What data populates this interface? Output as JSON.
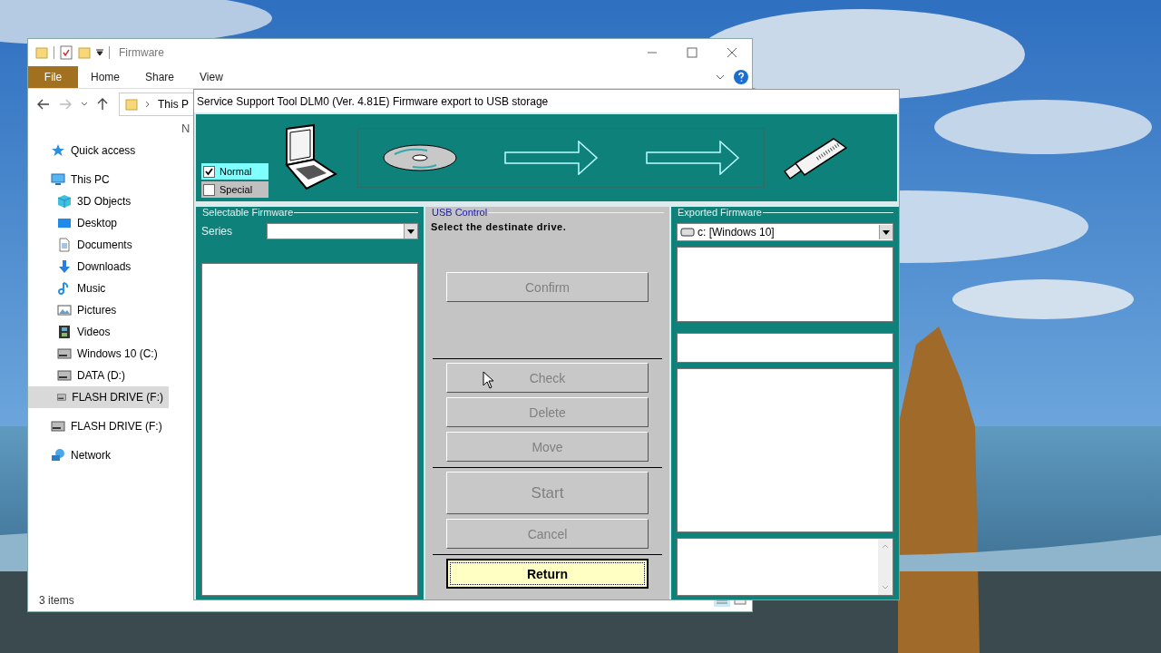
{
  "explorer": {
    "title": "Firmware",
    "ribbon_tabs": [
      {
        "label": "File",
        "selected": true
      },
      {
        "label": "Home",
        "selected": false
      },
      {
        "label": "Share",
        "selected": false
      },
      {
        "label": "View",
        "selected": false
      }
    ],
    "address": "This P",
    "column_1": "N",
    "nav": [
      {
        "label": "Quick access",
        "kind": "star",
        "selected": false
      },
      {
        "label": "This PC",
        "kind": "pc",
        "selected": false,
        "children": [
          {
            "label": "3D Objects",
            "kind": "cube",
            "selected": false
          },
          {
            "label": "Desktop",
            "kind": "desktop",
            "selected": false
          },
          {
            "label": "Documents",
            "kind": "document",
            "selected": false
          },
          {
            "label": "Downloads",
            "kind": "download",
            "selected": false
          },
          {
            "label": "Music",
            "kind": "music",
            "selected": false
          },
          {
            "label": "Pictures",
            "kind": "pictures",
            "selected": false
          },
          {
            "label": "Videos",
            "kind": "film",
            "selected": false
          },
          {
            "label": "Windows 10 (C:)",
            "kind": "drive",
            "selected": false
          },
          {
            "label": "DATA (D:)",
            "kind": "drive",
            "selected": false
          },
          {
            "label": "FLASH DRIVE (F:)",
            "kind": "drive",
            "selected": true
          }
        ]
      },
      {
        "label": "FLASH DRIVE (F:)",
        "kind": "drive",
        "selected": false
      },
      {
        "label": "Network",
        "kind": "network",
        "selected": false
      }
    ],
    "status": "3 items"
  },
  "dialog": {
    "title": "Service Support Tool DLM0 (Ver. 4.81E) Firmware export to USB storage",
    "modes": [
      {
        "label": "Normal",
        "checked": true
      },
      {
        "label": "Special",
        "checked": false
      }
    ],
    "selectable_firmware": {
      "legend": "Selectable Firmware",
      "series_label": "Series"
    },
    "usb_control": {
      "legend": "USB Control",
      "instruction": "Select the destinate drive.",
      "button_groups": [
        [
          {
            "label": "Confirm",
            "kind": "normal",
            "disabled": true
          }
        ],
        [
          {
            "label": "Check",
            "kind": "normal",
            "disabled": true
          },
          {
            "label": "Delete",
            "kind": "normal",
            "disabled": true
          },
          {
            "label": "Move",
            "kind": "normal",
            "disabled": true
          }
        ],
        [
          {
            "label": "Start",
            "kind": "large",
            "disabled": true
          },
          {
            "label": "Cancel",
            "kind": "normal",
            "disabled": true
          }
        ],
        [
          {
            "label": "Return",
            "kind": "normal",
            "disabled": false
          }
        ]
      ]
    },
    "exported_firmware": {
      "legend": "Exported Firmware",
      "drive": "c: [Windows 10]"
    }
  }
}
